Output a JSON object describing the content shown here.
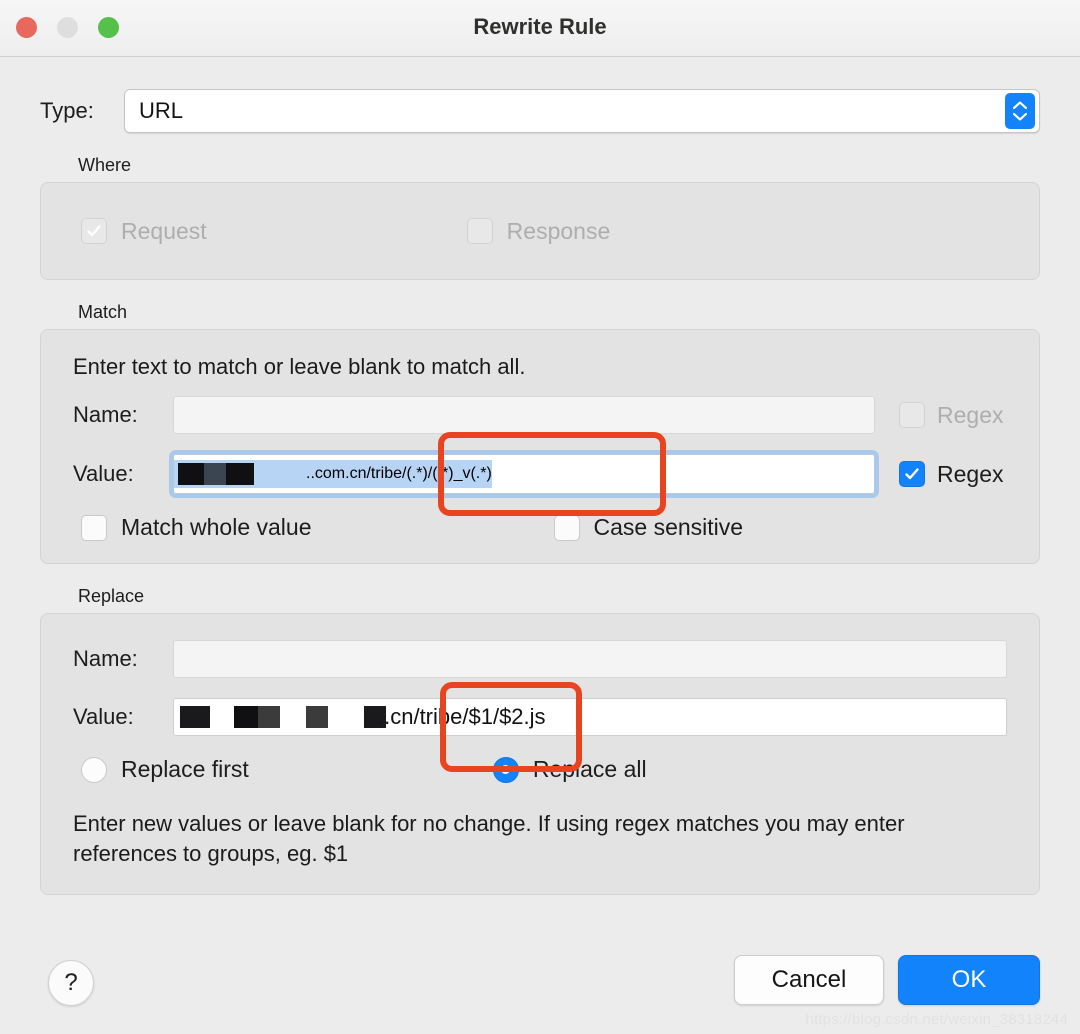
{
  "window": {
    "title": "Rewrite Rule",
    "traffic_lights": [
      {
        "name": "close",
        "color": "#e8685e"
      },
      {
        "name": "minimize",
        "color": "#dedede"
      },
      {
        "name": "maximize",
        "color": "#55c04a"
      }
    ]
  },
  "type_row": {
    "label": "Type:",
    "value": "URL",
    "options": [
      "URL"
    ],
    "stepper_icon": "chevron-up-down-icon",
    "accent": "#1283fb"
  },
  "where": {
    "group_label": "Where",
    "request": {
      "label": "Request",
      "checked": true,
      "enabled": false
    },
    "response": {
      "label": "Response",
      "checked": false,
      "enabled": false
    }
  },
  "match": {
    "group_label": "Match",
    "note": "Enter text to match or leave blank to match all.",
    "name": {
      "label": "Name:",
      "value": "",
      "regex_label": "Regex",
      "regex_checked": false,
      "regex_enabled": false
    },
    "value": {
      "label": "Value:",
      "text_redacted_prefix": "[redacted]",
      "text_visible": "..com.cn/tribe/(.*)/(.*)_v(.*)",
      "selected": true,
      "focused": true,
      "regex_label": "Regex",
      "regex_checked": true,
      "regex_enabled": true
    },
    "match_whole_value": {
      "label": "Match whole value",
      "checked": false
    },
    "case_sensitive": {
      "label": "Case sensitive",
      "checked": false
    }
  },
  "replace": {
    "group_label": "Replace",
    "name": {
      "label": "Name:",
      "value": ""
    },
    "value": {
      "label": "Value:",
      "text_redacted_prefix": "[redacted]",
      "text_visible": "..cn/tribe/$1/$2.js"
    },
    "replace_first": {
      "label": "Replace first",
      "selected": false
    },
    "replace_all": {
      "label": "Replace all",
      "selected": true
    },
    "help_text": "Enter new values or leave blank for no change. If using regex matches you may enter references to groups, eg. $1"
  },
  "footer": {
    "help_label": "?",
    "cancel_label": "Cancel",
    "ok_label": "OK",
    "ok_color": "#1283fb"
  },
  "annotations": {
    "color": "#e8441f",
    "boxes": [
      {
        "name": "match-regex-groups-highlight",
        "target": "/(.*)/(.*)_v(.*)"
      },
      {
        "name": "replace-group-refs-highlight",
        "target": "/$1/$2.js"
      }
    ]
  },
  "watermark": {
    "text": "https://blog.csdn.net/weixin_38318244"
  }
}
